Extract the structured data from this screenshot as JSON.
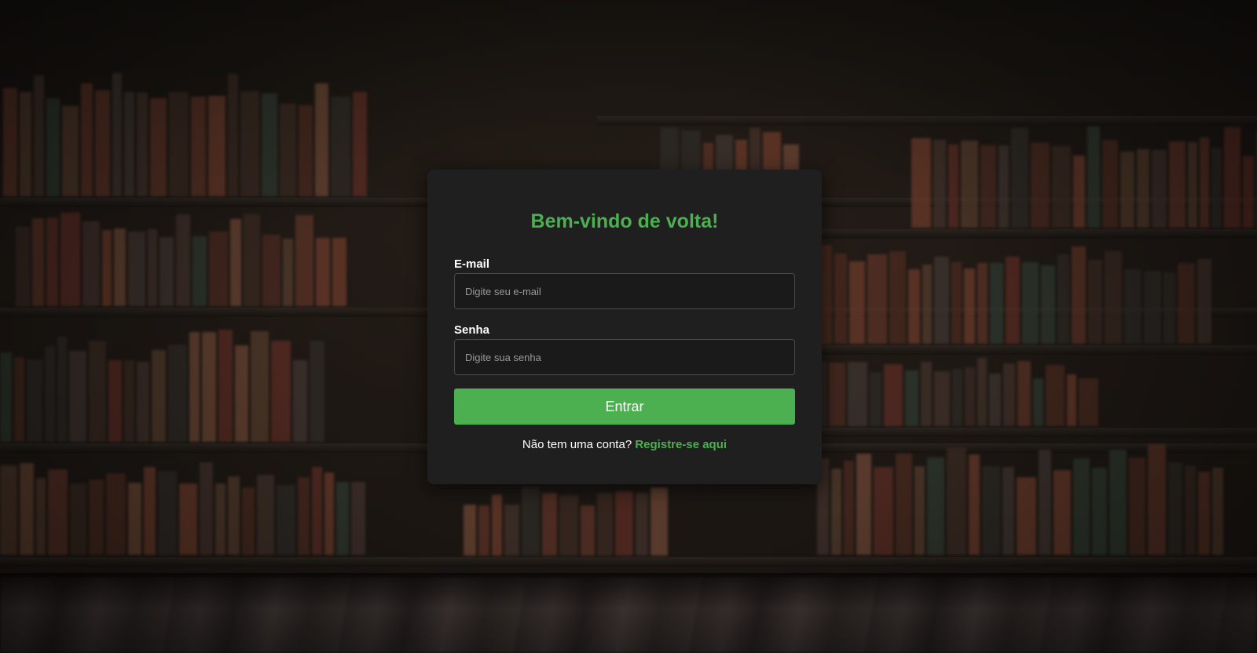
{
  "login": {
    "title": "Bem-vindo de volta!",
    "email_label": "E-mail",
    "email_placeholder": "Digite seu e-mail",
    "email_value": "",
    "password_label": "Senha",
    "password_placeholder": "Digite sua senha",
    "password_value": "",
    "submit_label": "Entrar",
    "register_prompt": "Não tem uma conta?",
    "register_link": "Registre-se aqui"
  },
  "colors": {
    "accent": "#4caf50",
    "card_background": "#1f1f1f",
    "input_background": "#1a1a1a",
    "text": "#ffffff"
  }
}
